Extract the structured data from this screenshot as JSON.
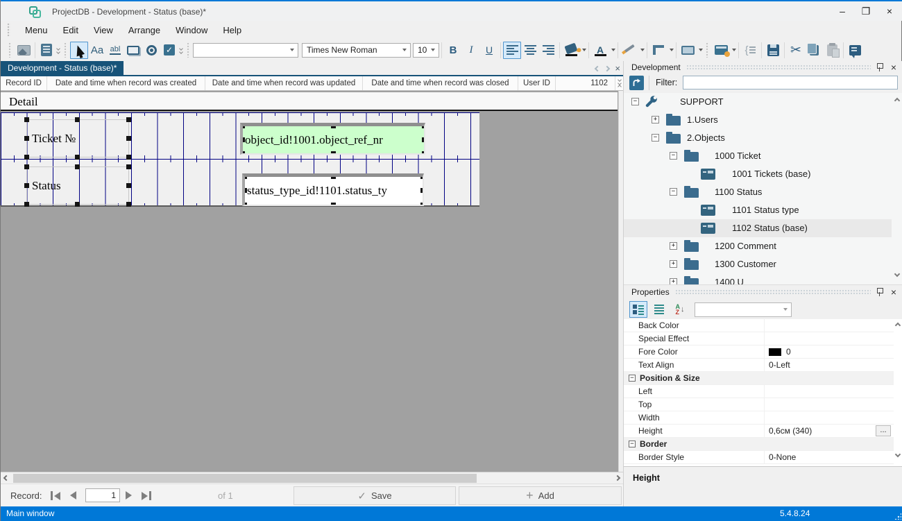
{
  "window": {
    "title": "ProjectDB - Development - Status (base)*",
    "status_left": "Main window",
    "version": "5.4.8.24"
  },
  "menu": {
    "items": [
      "Menu",
      "Edit",
      "View",
      "Arrange",
      "Window",
      "Help"
    ]
  },
  "toolbar": {
    "label_tool": "Aa",
    "textbox_tool": "abl",
    "style_combo_value": "",
    "font_name": "Times New Roman",
    "font_size": "10",
    "bold": "B",
    "italic": "I",
    "underline": "U",
    "font_color_letter": "A"
  },
  "tabs": [
    {
      "label": "Development - Status (base)*"
    }
  ],
  "columns": [
    "Record ID",
    "Date and time when record was created",
    "Date and time when record was updated",
    "Date and time when record was closed",
    "User ID",
    "1102"
  ],
  "designer": {
    "section_label": "Detail",
    "label_ticket": "Ticket №",
    "field_ticket": "object_id!1001.object_ref_nr",
    "label_status": "Status",
    "field_status": "status_type_id!1101.status_ty"
  },
  "dev_panel": {
    "title": "Development",
    "filter_label": "Filter:",
    "filter_value": "",
    "tree": [
      {
        "label": "SUPPORT",
        "icon": "wrench",
        "expander": "minus"
      },
      {
        "label": "1.Users",
        "icon": "folder",
        "expander": "plus"
      },
      {
        "label": "2.Objects",
        "icon": "folder",
        "expander": "minus"
      },
      {
        "label": "1000 Ticket",
        "icon": "folder",
        "expander": "minus"
      },
      {
        "label": "1001 Tickets (base)",
        "icon": "form",
        "expander": "none"
      },
      {
        "label": "1100 Status",
        "icon": "folder",
        "expander": "minus"
      },
      {
        "label": "1101 Status type",
        "icon": "form",
        "expander": "none"
      },
      {
        "label": "1102 Status (base)",
        "icon": "form",
        "expander": "none",
        "selected": true
      },
      {
        "label": "1200 Comment",
        "icon": "folder",
        "expander": "plus"
      },
      {
        "label": "1300 Customer",
        "icon": "folder",
        "expander": "plus"
      },
      {
        "label": "1400 U",
        "icon": "folder",
        "expander": "plus",
        "clipped": true
      }
    ]
  },
  "properties": {
    "title": "Properties",
    "combo_value": "",
    "rows": [
      {
        "type": "prop",
        "name": "Back Color",
        "value": ""
      },
      {
        "type": "prop",
        "name": "Special Effect",
        "value": ""
      },
      {
        "type": "prop",
        "name": "Fore Color",
        "value": "0",
        "swatch": "#000000"
      },
      {
        "type": "prop",
        "name": "Text Align",
        "value": "0-Left"
      },
      {
        "type": "category",
        "name": "Position & Size",
        "value": ""
      },
      {
        "type": "prop",
        "name": "Left",
        "value": ""
      },
      {
        "type": "prop",
        "name": "Top",
        "value": ""
      },
      {
        "type": "prop",
        "name": "Width",
        "value": ""
      },
      {
        "type": "prop",
        "name": "Height",
        "value": "0,6см (340)",
        "ellipsis_button": true
      },
      {
        "type": "category",
        "name": "Border",
        "value": ""
      },
      {
        "type": "prop",
        "name": "Border Style",
        "value": "0-None"
      }
    ],
    "description_title": "Height"
  },
  "record_bar": {
    "label": "Record:",
    "current": "1",
    "of_label": "of  1",
    "save_label": "Save",
    "add_label": "Add"
  },
  "icons": {
    "check": "✓",
    "plus": "+",
    "cut": "✂",
    "close": "×",
    "minimize": "–",
    "maximize": "❐",
    "ellipsis": "...",
    "expand_plus": "+",
    "collapse_minus": "−"
  },
  "colors": {
    "accent": "#0078d7",
    "tab_selected": "#175379",
    "grid_line": "#000082",
    "field_highlight": "#ccffcc",
    "icon_slate": "#33647f",
    "status_bar": "#0078d7"
  }
}
